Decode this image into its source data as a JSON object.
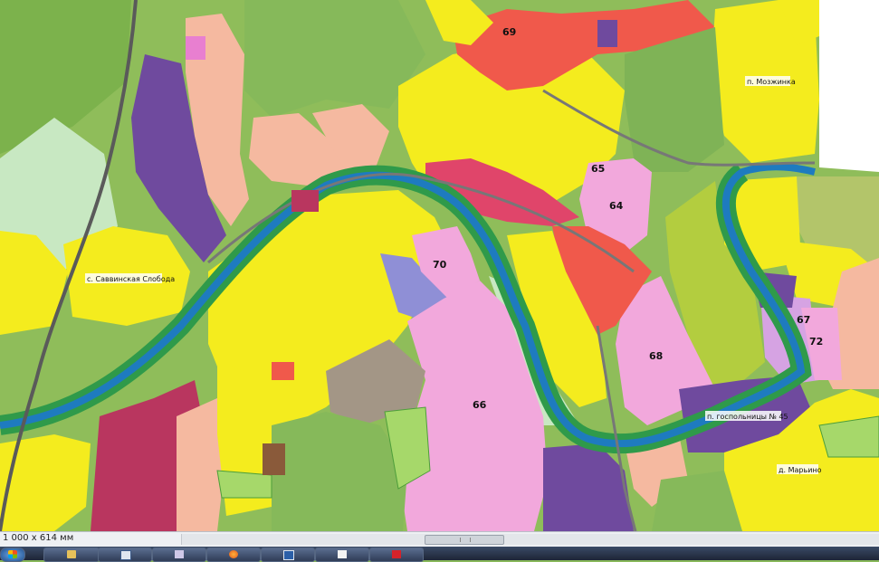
{
  "viewer": {
    "scale_text": "1 000 x 614 мм"
  },
  "map": {
    "zones": [
      {
        "id": "64",
        "label": "64"
      },
      {
        "id": "65",
        "label": "65"
      },
      {
        "id": "66",
        "label": "66"
      },
      {
        "id": "67",
        "label": "67"
      },
      {
        "id": "68",
        "label": "68"
      },
      {
        "id": "69",
        "label": "69"
      },
      {
        "id": "70",
        "label": "70"
      },
      {
        "id": "72",
        "label": "72"
      }
    ],
    "places": [
      {
        "id": "savvinskaya",
        "label": "с. Саввинская Слобода"
      },
      {
        "id": "mozzhinka",
        "label": "п. Мозжинка"
      },
      {
        "id": "hospital",
        "label": "п. госпольницы № 45"
      },
      {
        "id": "marino",
        "label": "д. Марьино"
      }
    ],
    "colors": {
      "residential": "#f4ec1e",
      "agricultural": "#8fbd5a",
      "forest": "#6aa84f",
      "commercial": "#f0594b",
      "industrial": "#6f4a9e",
      "recreational": "#f2a8dc",
      "water": "#1e7bbf",
      "riverbank": "#2f9a4a",
      "special": "#b9365f",
      "salmon": "#f5b9a0"
    }
  },
  "taskbar": {
    "apps": [
      {
        "id": "start",
        "icon": "windows-icon"
      },
      {
        "id": "explorer",
        "icon": "folder-icon"
      },
      {
        "id": "app2",
        "icon": "window-icon"
      },
      {
        "id": "app3",
        "icon": "envelope-icon"
      },
      {
        "id": "firefox",
        "icon": "firefox-icon"
      },
      {
        "id": "save",
        "icon": "floppy-icon"
      },
      {
        "id": "app6",
        "icon": "document-icon"
      },
      {
        "id": "app7",
        "icon": "red-app-icon"
      }
    ]
  }
}
